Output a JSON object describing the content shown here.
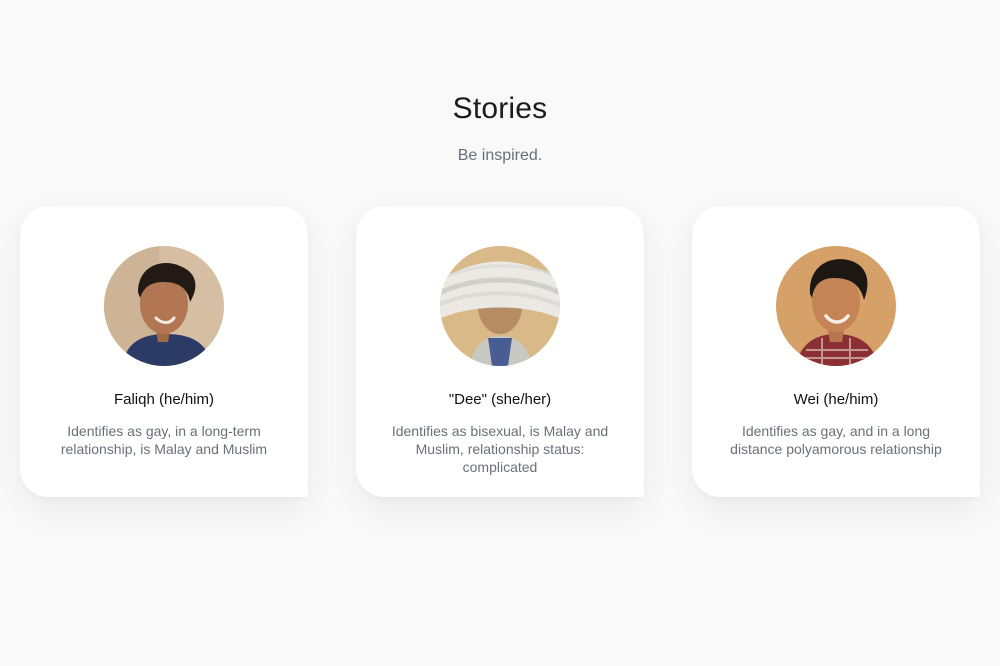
{
  "header": {
    "title": "Stories",
    "subtitle": "Be inspired."
  },
  "stories": [
    {
      "name": "Faliqh (he/him)",
      "description": "Identifies as gay, in a long-term relationship, is Malay and Muslim",
      "avatar_icon": "person-portrait-icon"
    },
    {
      "name": "\"Dee\" (she/her)",
      "description": "Identifies as bisexual, is Malay and Muslim, relationship status: complicated",
      "avatar_icon": "person-portrait-blurred-icon"
    },
    {
      "name": "Wei (he/him)",
      "description": "Identifies as gay, and in a long distance polyamorous relationship",
      "avatar_icon": "person-portrait-icon"
    }
  ],
  "colors": {
    "background": "#f9f9f9",
    "card": "#ffffff",
    "title_text": "#1c1c1c",
    "muted_text": "#6b6f7a"
  }
}
